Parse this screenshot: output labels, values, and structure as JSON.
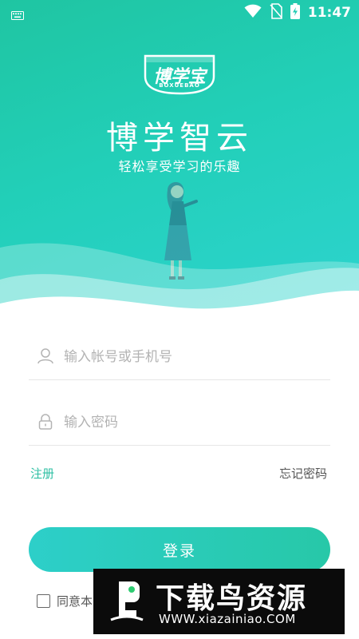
{
  "status_bar": {
    "time": "11:47",
    "icons": [
      "keyboard-icon",
      "wifi-icon",
      "no-sim-icon",
      "battery-charging-icon"
    ]
  },
  "logo": {
    "text": "博学宝",
    "subtext": "BOXUEBAO"
  },
  "header": {
    "title": "博学智云",
    "slogan": "轻松享受学习的乐趣"
  },
  "form": {
    "account_placeholder": "输入帐号或手机号",
    "password_placeholder": "输入密码",
    "account_icon": "user-icon",
    "password_icon": "lock-icon"
  },
  "links": {
    "register": "注册",
    "forgot_password": "忘记密码"
  },
  "login_button": "登录",
  "agreement": {
    "text": "同意本",
    "checked": false
  },
  "watermark": {
    "title": "下载鸟资源",
    "url": "WWW.xiazainiao.COM"
  },
  "colors": {
    "accent": "#2dbfa3",
    "gradient_start": "#1fc5a2",
    "gradient_end": "#2dd4cf"
  }
}
